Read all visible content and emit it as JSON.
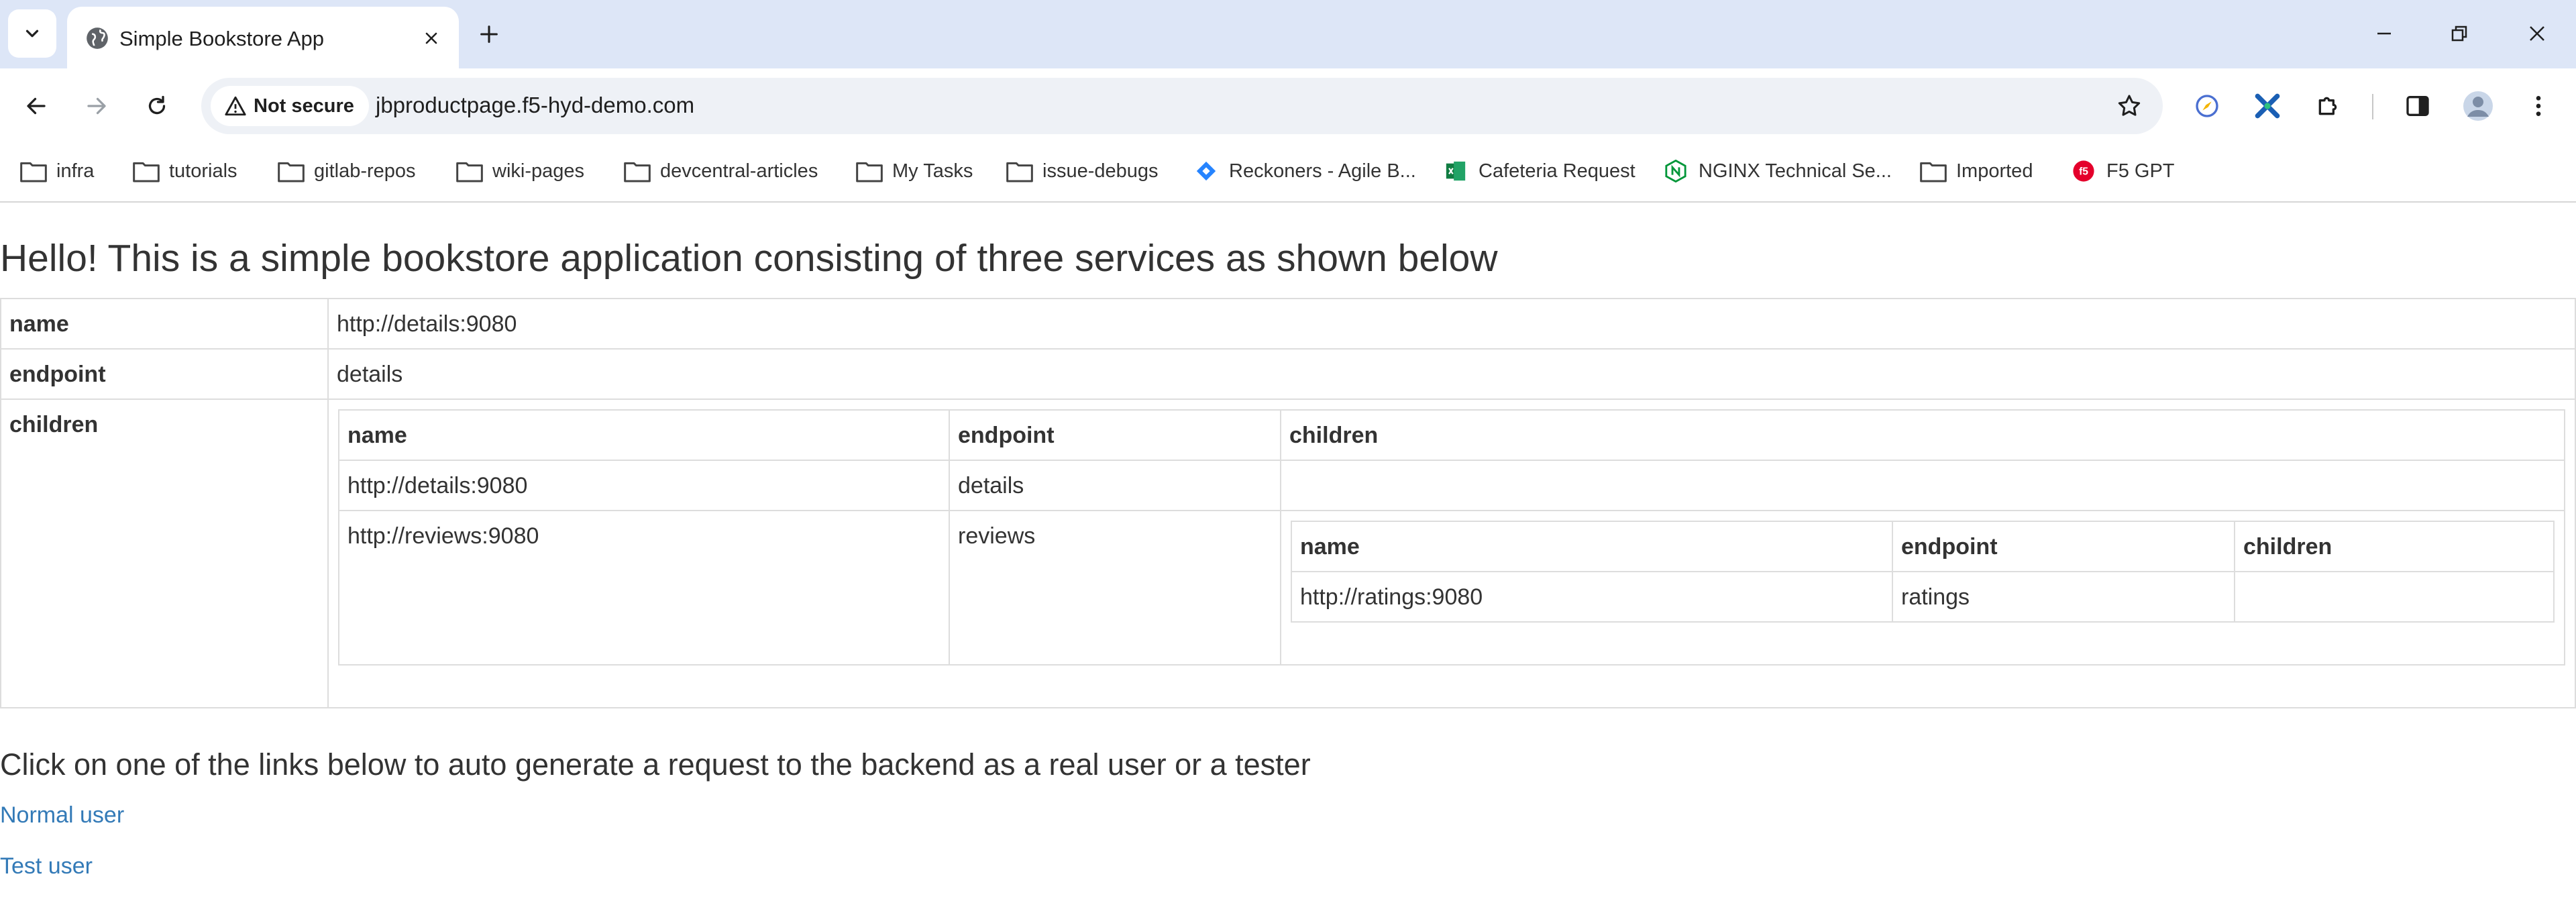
{
  "browser": {
    "tab": {
      "title": "Simple Bookstore App"
    },
    "omnibox": {
      "security_label": "Not secure",
      "url": "jbproductpage.f5-hyd-demo.com"
    },
    "bookmarks": [
      {
        "label": "infra",
        "icon": "folder-icon"
      },
      {
        "label": "tutorials",
        "icon": "folder-icon"
      },
      {
        "label": "gitlab-repos",
        "icon": "folder-icon"
      },
      {
        "label": "wiki-pages",
        "icon": "folder-icon"
      },
      {
        "label": "devcentral-articles",
        "icon": "folder-icon"
      },
      {
        "label": "My Tasks",
        "icon": "folder-icon"
      },
      {
        "label": "issue-debugs",
        "icon": "folder-icon"
      },
      {
        "label": "Reckoners - Agile B...",
        "icon": "jira-icon"
      },
      {
        "label": "Cafeteria Request",
        "icon": "sheet-icon"
      },
      {
        "label": "NGINX Technical Se...",
        "icon": "nginx-icon"
      },
      {
        "label": "Imported",
        "icon": "folder-icon"
      },
      {
        "label": "F5 GPT",
        "icon": "f5-icon"
      }
    ],
    "colors": {
      "titlebar": "#dde6f7",
      "omnibox": "#eef1f6",
      "link": "#337ab7"
    }
  },
  "page": {
    "headline": "Hello! This is a simple bookstore application consisting of three services as shown below",
    "table": {
      "name_key": "name",
      "name_value": "http://details:9080",
      "endpoint_key": "endpoint",
      "endpoint_value": "details",
      "children_key": "children",
      "children": {
        "headers": [
          "name",
          "endpoint",
          "children"
        ],
        "rows": [
          {
            "name": "http://details:9080",
            "endpoint": "details"
          },
          {
            "name": "http://reviews:9080",
            "endpoint": "reviews"
          }
        ],
        "nested": {
          "headers": [
            "name",
            "endpoint",
            "children"
          ],
          "rows": [
            {
              "name": "http://ratings:9080",
              "endpoint": "ratings"
            }
          ]
        }
      }
    },
    "prompt": "Click on one of the links below to auto generate a request to the backend as a real user or a tester",
    "links": {
      "normal_user": "Normal user",
      "test_user": "Test user"
    }
  }
}
